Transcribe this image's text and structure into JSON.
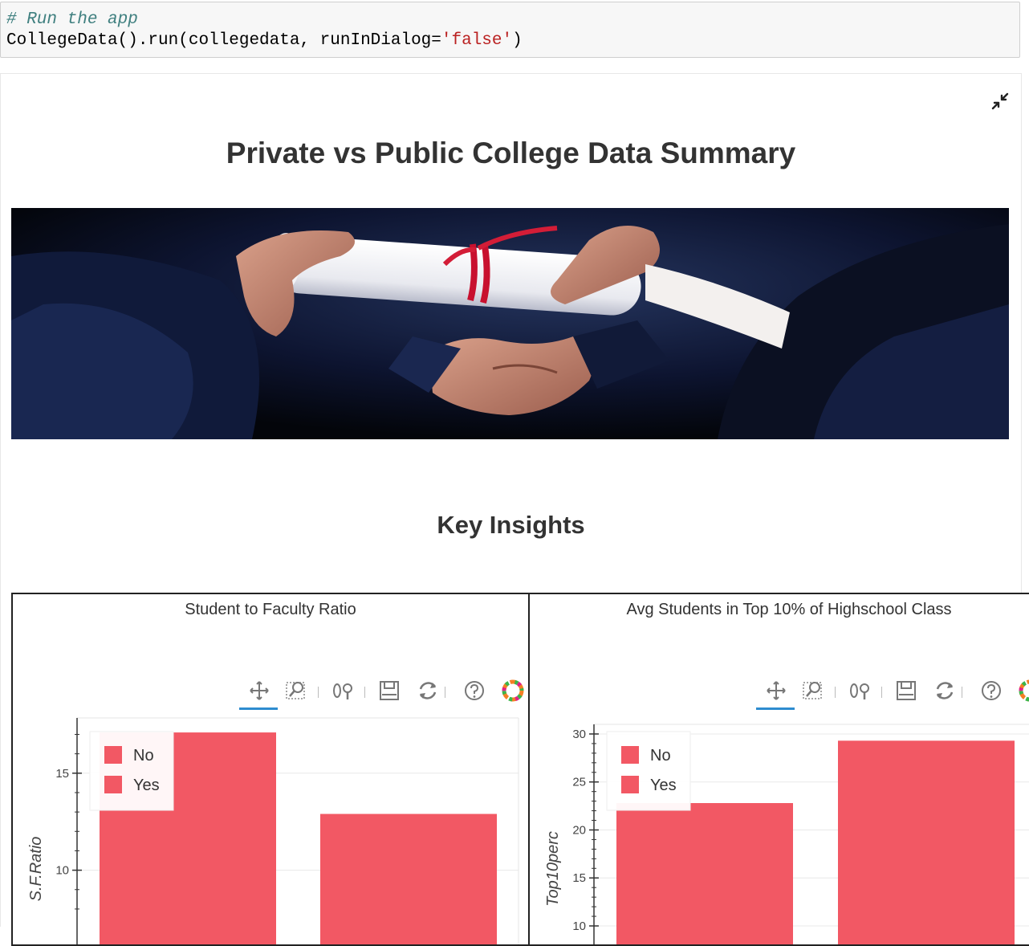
{
  "code_cell": {
    "comment": "# Run the app",
    "line2_prefix": "CollegeData().run(collegedata, runInDialog=",
    "line2_string": "'false'",
    "line2_suffix": ")"
  },
  "output": {
    "title": "Private vs Public College Data Summary",
    "section_title": "Key Insights",
    "collapse_icon": "collapse-arrows-icon",
    "banner_description_icon": "diploma-handover-photo"
  },
  "colors": {
    "bar": "#f25864",
    "title_text": "#333333",
    "toolbar_active": "#2e8ccf"
  },
  "toolbar_icons": [
    "pan-icon",
    "box-zoom-icon",
    "wheel-zoom-icon",
    "save-icon",
    "reset-icon",
    "help-icon",
    "bokeh-logo-icon"
  ],
  "chart_data": [
    {
      "type": "bar",
      "title": "Student to Faculty Ratio",
      "ylabel": "S.F.Ratio",
      "xlabel": "",
      "categories": [
        "No",
        "Yes"
      ],
      "values": [
        17.1,
        12.9
      ],
      "yticks": [
        10,
        15
      ],
      "ylim": [
        7.5,
        17.6
      ],
      "legend": [
        "No",
        "Yes"
      ],
      "legend_position": "top-left",
      "grid": true
    },
    {
      "type": "bar",
      "title": "Avg Students in Top 10% of Highschool Class",
      "ylabel": "Top10perc",
      "xlabel": "",
      "categories": [
        "No",
        "Yes"
      ],
      "values": [
        22.8,
        29.3
      ],
      "yticks": [
        10,
        15,
        20,
        25,
        30
      ],
      "ylim": [
        10,
        30.5
      ],
      "legend": [
        "No",
        "Yes"
      ],
      "legend_position": "top-left",
      "grid": true
    }
  ]
}
